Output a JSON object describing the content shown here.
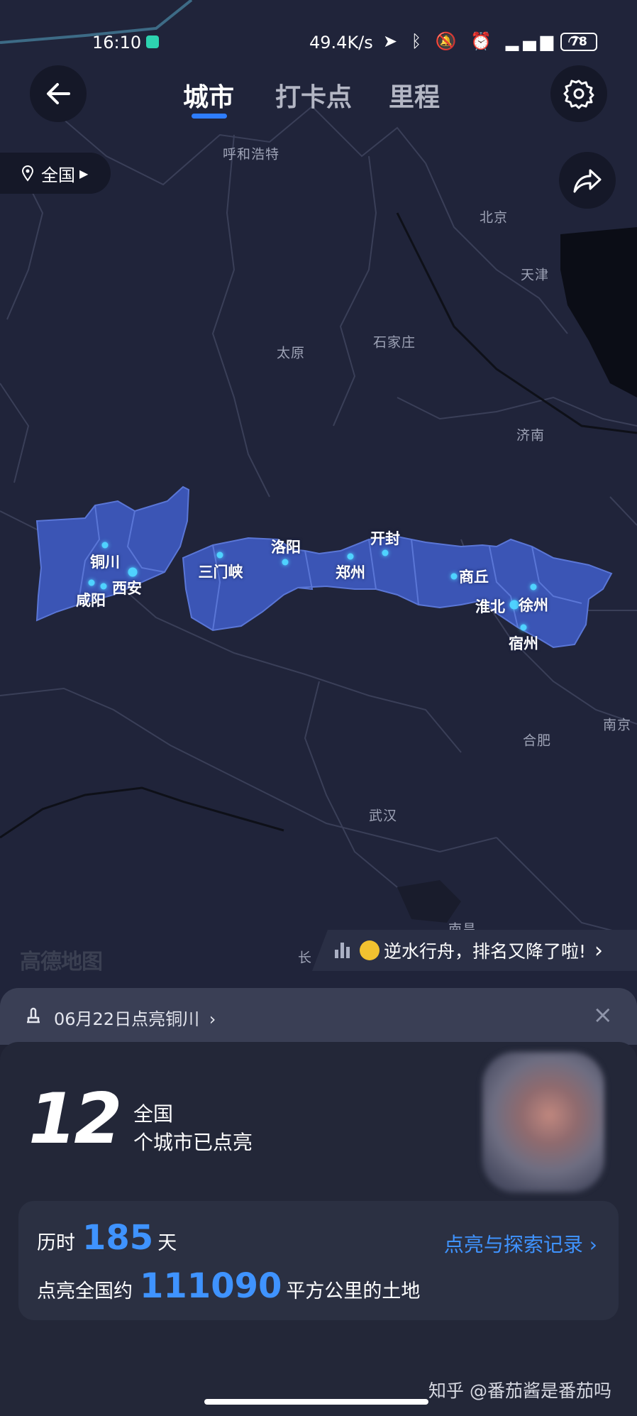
{
  "status_bar": {
    "time": "16:10",
    "network_speed": "49.4K/s",
    "battery": "78",
    "icons": [
      "location-icon",
      "bluetooth-icon",
      "mute-icon",
      "alarm-icon",
      "signal-icon",
      "wifi-icon"
    ]
  },
  "nav": {
    "tabs": [
      {
        "label": "城市",
        "active": true
      },
      {
        "label": "打卡点",
        "active": false
      },
      {
        "label": "里程",
        "active": false
      }
    ]
  },
  "region_selector": {
    "label": "全国"
  },
  "map": {
    "region_color": "#3b55b5",
    "dot_color": "#4fd2ff",
    "cities": [
      "呼和浩特",
      "北京",
      "天津",
      "太原",
      "石家庄",
      "济南",
      "南京",
      "合肥",
      "武汉",
      "南昌",
      "长"
    ],
    "lit_cities": [
      "铜川",
      "西安",
      "咸阳",
      "三门峡",
      "洛阳",
      "郑州",
      "开封",
      "商丘",
      "淮北",
      "徐州",
      "宿州"
    ],
    "logo": "高德地图"
  },
  "rank_banner": {
    "text": "逆水行舟，排名又降了啦!",
    "emoji": "worried-face",
    "chevron": "›"
  },
  "sheet": {
    "header_message": "06月22日点亮铜川",
    "header_chevron": "›",
    "close": "×",
    "count": "12",
    "scope": "全国",
    "count_desc": "个城市已点亮",
    "stats": {
      "duration_prefix": "历时",
      "duration_days": "185",
      "duration_suffix": "天",
      "area_prefix": "点亮全国约",
      "area_value": "111090",
      "area_suffix": "平方公里的土地",
      "link": "点亮与探索记录 ›"
    }
  },
  "footer": {
    "brand": "知乎 @番茄酱是番茄吗"
  }
}
